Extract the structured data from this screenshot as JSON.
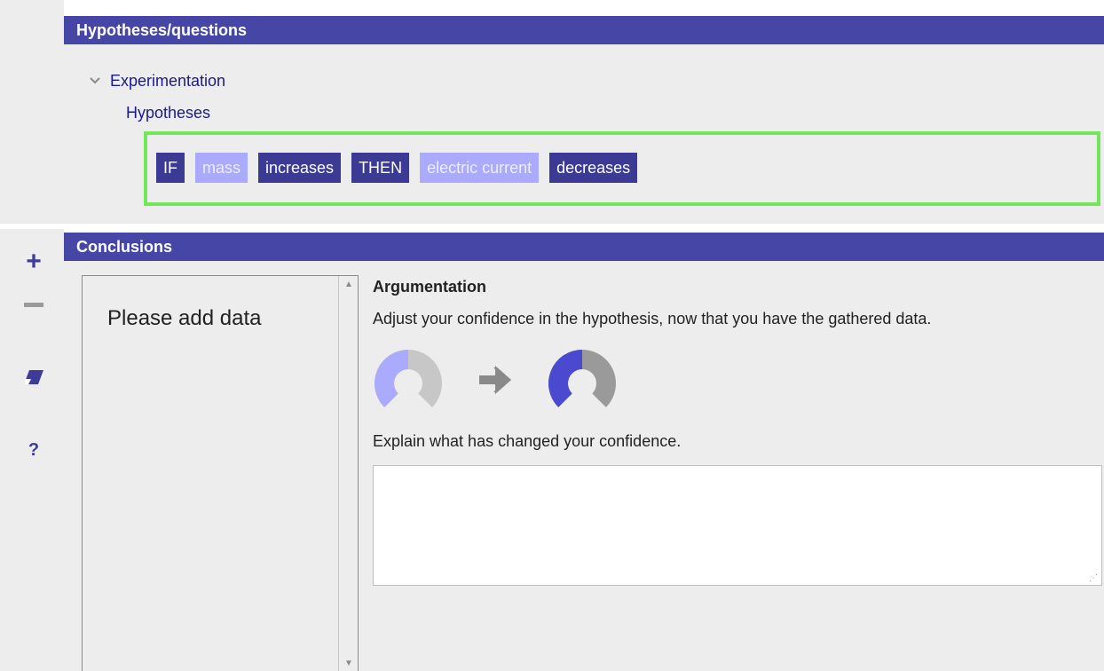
{
  "toolbar": {
    "add_label": "+",
    "help_label": "?",
    "icons": [
      "plus-icon",
      "minus-icon",
      "eraser-icon",
      "question-icon"
    ]
  },
  "hypotheses_panel": {
    "title": "Hypotheses/questions",
    "tree": {
      "root_label": "Experimentation",
      "child_label": "Hypotheses"
    },
    "hypothesis": [
      {
        "text": "IF",
        "style": "dark"
      },
      {
        "text": "mass",
        "style": "light"
      },
      {
        "text": "increases",
        "style": "dark"
      },
      {
        "text": "THEN",
        "style": "dark"
      },
      {
        "text": "electric current",
        "style": "light"
      },
      {
        "text": "decreases",
        "style": "dark"
      }
    ],
    "highlight_color": "#73e65a"
  },
  "conclusions_panel": {
    "title": "Conclusions",
    "data_list": {
      "placeholder": "Please add data"
    },
    "argumentation": {
      "title": "Argumentation",
      "prompt": "Adjust your confidence in the hypothesis, now that you have the gathered data.",
      "confidence_before": 0.5,
      "confidence_after": 0.5,
      "confidence_before_color": "#aaaaff",
      "confidence_after_color": "#4a4ad0",
      "explain_label": "Explain what has changed your confidence.",
      "explanation_value": ""
    }
  },
  "colors": {
    "header_bg": "#4646a6",
    "accent": "#3b3b96"
  }
}
